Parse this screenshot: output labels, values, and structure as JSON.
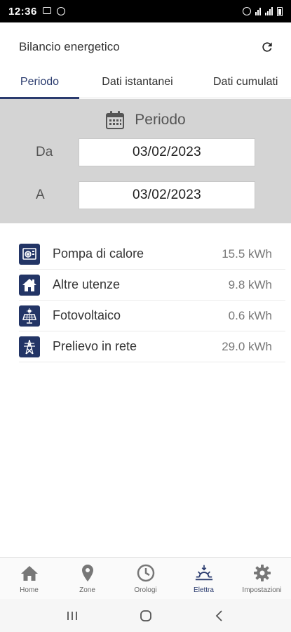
{
  "status_bar": {
    "time": "12:36"
  },
  "header": {
    "title": "Bilancio energetico",
    "refresh_icon": "refresh-icon"
  },
  "tabs": [
    {
      "label": "Periodo",
      "active": true
    },
    {
      "label": "Dati istantanei",
      "active": false
    },
    {
      "label": "Dati cumulati",
      "active": false
    }
  ],
  "period": {
    "title": "Periodo",
    "icon": "calendar-icon",
    "from_label": "Da",
    "from_value": "03/02/2023",
    "to_label": "A",
    "to_value": "03/02/2023"
  },
  "energy": [
    {
      "label": "Pompa di calore",
      "value": "15.5 kWh",
      "icon": "heat-pump-icon"
    },
    {
      "label": "Altre utenze",
      "value": "9.8 kWh",
      "icon": "house-icon"
    },
    {
      "label": "Fotovoltaico",
      "value": "0.6 kWh",
      "icon": "solar-panel-icon"
    },
    {
      "label": "Prelievo in rete",
      "value": "29.0 kWh",
      "icon": "power-pylon-icon"
    }
  ],
  "bottom_nav": [
    {
      "label": "Home",
      "icon": "home-icon",
      "active": false
    },
    {
      "label": "Zone",
      "icon": "map-pin-icon",
      "active": false
    },
    {
      "label": "Orologi",
      "icon": "clock-icon",
      "active": false
    },
    {
      "label": "Elettra",
      "icon": "sunrise-icon",
      "active": true
    },
    {
      "label": "Impostazioni",
      "icon": "gear-icon",
      "active": false
    }
  ],
  "colors": {
    "accent": "#2a3b6e",
    "icon_bg": "#233566",
    "panel_bg": "#d4d4d4"
  }
}
